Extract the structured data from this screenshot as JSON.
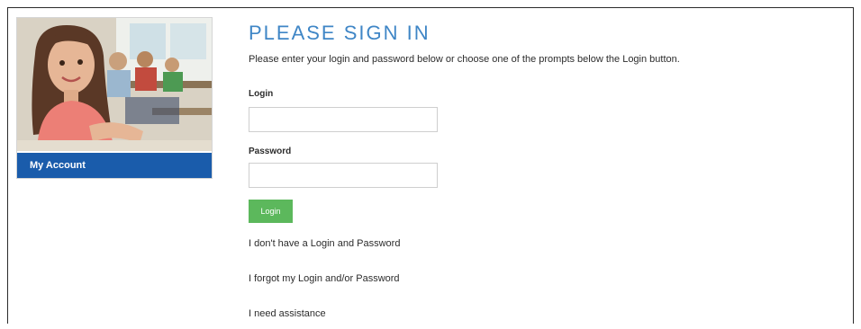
{
  "sidebar": {
    "photo_alt": "Smiling girl in a classroom",
    "account_label": "My Account"
  },
  "signin": {
    "title": "PLEASE SIGN IN",
    "instructions": "Please enter your login and password below or choose one of the prompts below the Login button.",
    "login_label": "Login",
    "login_value": "",
    "password_label": "Password",
    "password_value": "",
    "login_button": "Login"
  },
  "help_links": [
    "I don't have a Login and Password",
    "I forgot my Login and/or Password",
    "I need assistance"
  ],
  "colors": {
    "title": "#3f86c6",
    "sidebar_tab": "#1a5cab",
    "login_button": "#5cb85c"
  }
}
